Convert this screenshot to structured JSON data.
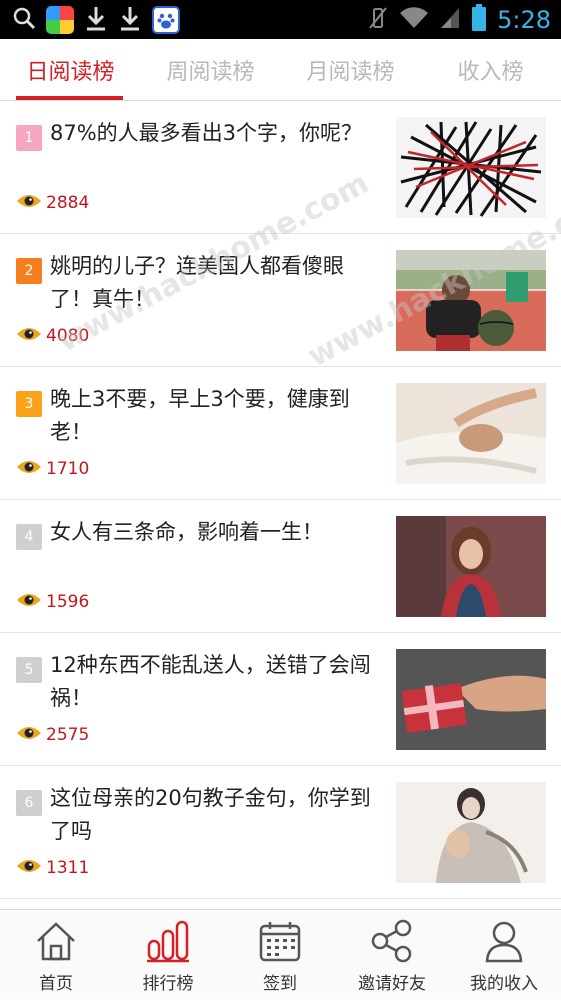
{
  "status_bar": {
    "time": "5:28",
    "icons": [
      "search-icon",
      "app-store-icon",
      "download-icon",
      "download-icon",
      "baidu-icon",
      "vibrate-off-icon",
      "wifi-icon",
      "signal-icon",
      "battery-icon"
    ]
  },
  "tabs": [
    {
      "label": "日阅读榜",
      "active": true
    },
    {
      "label": "周阅读榜",
      "active": false
    },
    {
      "label": "月阅读榜",
      "active": false
    },
    {
      "label": "收入榜",
      "active": false
    }
  ],
  "articles": [
    {
      "rank": "1",
      "title": "87%的人最多看出3个字，你呢？",
      "views": "2884",
      "rank_color": "#f7a6bf",
      "thumb": "abstract-lines-image"
    },
    {
      "rank": "2",
      "title": "姚明的儿子？连美国人都看傻眼了！真牛！",
      "views": "4080",
      "rank_color": "#f57e1e",
      "thumb": "boy-basketball-image"
    },
    {
      "rank": "3",
      "title": "晚上3不要，早上3个要，健康到老！",
      "views": "1710",
      "rank_color": "#f9a21a",
      "thumb": "sleeping-woman-image"
    },
    {
      "rank": "4",
      "title": "女人有三条命，影响着一生！",
      "views": "1596",
      "rank_color": "#cfcfcf",
      "thumb": "woman-portrait-image"
    },
    {
      "rank": "5",
      "title": "12种东西不能乱送人，送错了会闯祸！",
      "views": "2575",
      "rank_color": "#cfcfcf",
      "thumb": "gift-box-image"
    },
    {
      "rank": "6",
      "title": "这位母亲的20句教子金句，你学到了吗",
      "views": "1311",
      "rank_color": "#cfcfcf",
      "thumb": "mother-child-painting-image"
    }
  ],
  "bottom_nav": [
    {
      "label": "首页",
      "icon": "home-icon",
      "active": false
    },
    {
      "label": "排行榜",
      "icon": "bar-chart-icon",
      "active": true
    },
    {
      "label": "签到",
      "icon": "calendar-icon",
      "active": false
    },
    {
      "label": "邀请好友",
      "icon": "share-icon",
      "active": false
    },
    {
      "label": "我的收入",
      "icon": "user-icon",
      "active": false
    }
  ],
  "colors": {
    "accent": "#d61f24",
    "views_text": "#c4161c",
    "status_blue": "#35b5e5"
  }
}
